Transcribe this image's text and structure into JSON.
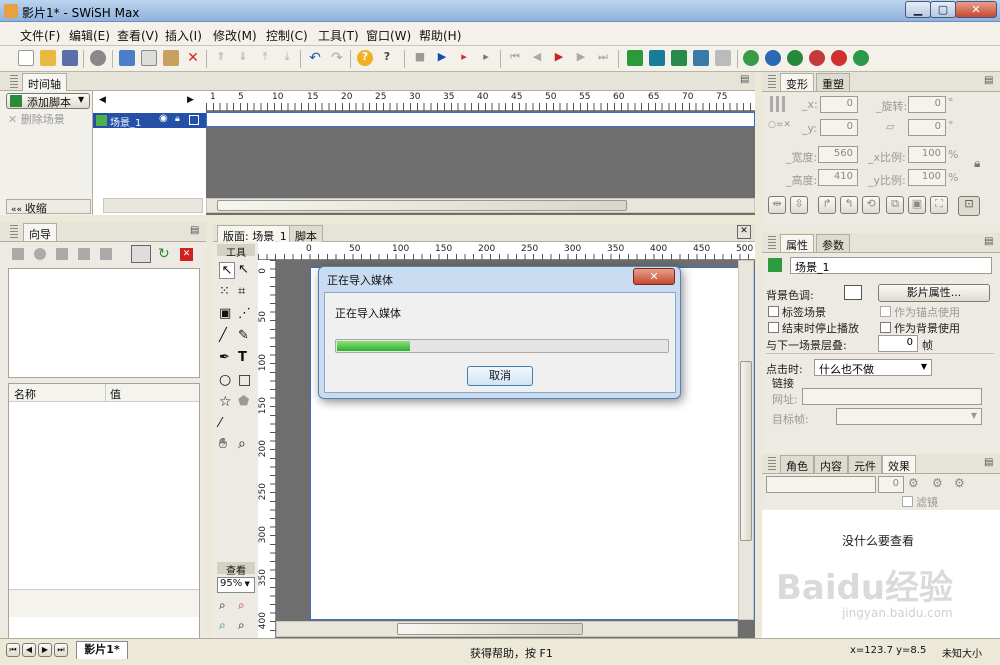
{
  "window": {
    "title": "影片1* - SWiSH Max"
  },
  "menu": [
    "文件(F)",
    "编辑(E)",
    "查看(V)",
    "插入(I)",
    "修改(M)",
    "控制(C)",
    "工具(T)",
    "窗口(W)",
    "帮助(H)"
  ],
  "timeline": {
    "tab": "时间轴",
    "add_script": "添加脚本",
    "delete_scene": "删除场景",
    "scene_name": "场景_1",
    "collapse": "收缩",
    "ruler": [
      "1",
      "5",
      "10",
      "15",
      "20",
      "25",
      "30",
      "35",
      "40",
      "45",
      "50",
      "55",
      "60",
      "65",
      "70",
      "75"
    ]
  },
  "wizard": {
    "tab": "向导",
    "col_name": "名称",
    "col_value": "值"
  },
  "stage": {
    "tab_layout": "版面: 场景_1",
    "tab_script": "脚本",
    "tools_label": "工具",
    "view_label": "查看",
    "zoom": "95%",
    "hruler": [
      "0",
      "50",
      "100",
      "150",
      "200",
      "250",
      "300",
      "350",
      "400",
      "450",
      "500"
    ],
    "vruler": [
      "0",
      "50",
      "100",
      "150",
      "200",
      "250",
      "300",
      "350",
      "400"
    ]
  },
  "dialog": {
    "title": "正在导入媒体",
    "message": "正在导入媒体",
    "progress": 0.22,
    "cancel": "取消",
    "close_glyph": "✕"
  },
  "transform": {
    "tab_transform": "变形",
    "tab_reshape": "重塑",
    "x_label": "_x:",
    "x": "0",
    "y_label": "_y:",
    "y": "0",
    "rotate_label": "_旋转:",
    "rotate": "0",
    "skew": "0",
    "width_label": "_宽度:",
    "width": "560",
    "height_label": "_高度:",
    "height": "410",
    "xscale_label": "_x比例:",
    "xscale": "100",
    "yscale_label": "_y比例:",
    "yscale": "100",
    "deg": "°",
    "pct": "%",
    "ox_label": "○=✕"
  },
  "properties": {
    "tab_props": "属性",
    "tab_params": "参数",
    "scene_name": "场景_1",
    "bg_color_label": "背景色调:",
    "movie_props_btn": "影片属性...",
    "label_scene": "标签场景",
    "as_anchor": "作为锚点使用",
    "stop_at_end": "结束时停止播放",
    "as_background": "作为背景使用",
    "next_layer": "与下一场景层叠:",
    "next_layer_value": "0",
    "frames_unit": "帧",
    "on_click_label": "点击时:",
    "on_click_value": "什么也不做",
    "link_label": "链接",
    "url_label": "网址:",
    "target_label": "目标帧:"
  },
  "effects": {
    "tabs": [
      "角色",
      "内容",
      "元件",
      "效果"
    ],
    "frames": "0",
    "filter_label": "滤镜",
    "empty_msg": "没什么要查看"
  },
  "status": {
    "help": "获得帮助，按 F1",
    "coords": "x=123.7 y=8.5",
    "size": "未知大小",
    "doc_tab": "影片1*"
  },
  "watermark": {
    "line1": "Baidu经验",
    "line2": "jingyan.baidu.com"
  }
}
